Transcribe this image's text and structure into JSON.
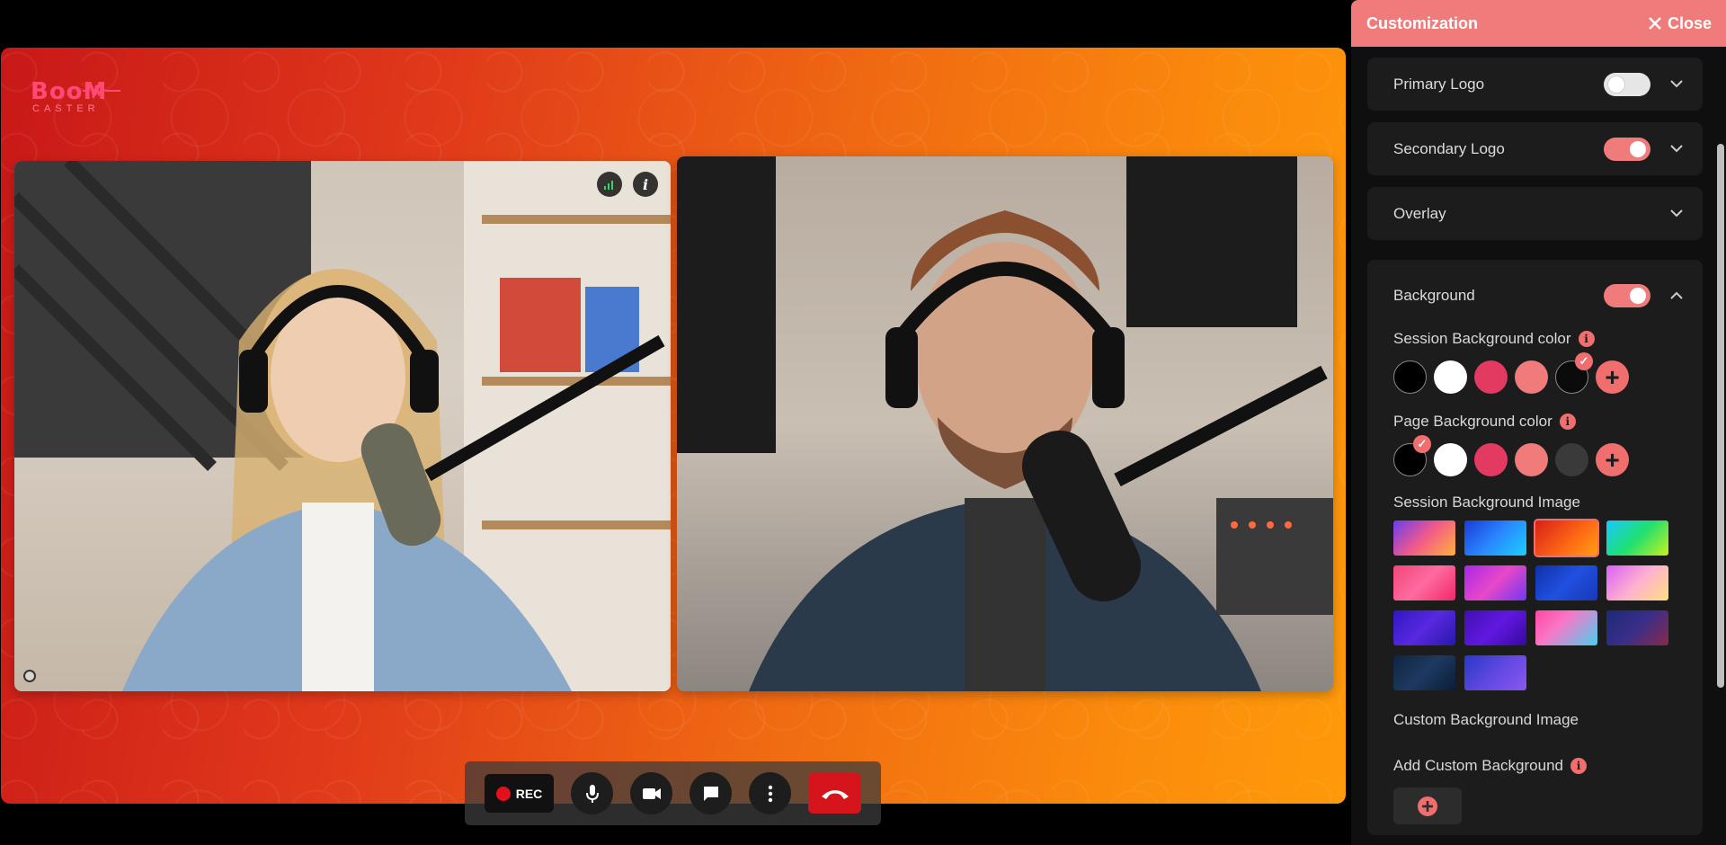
{
  "brand": {
    "name_top": "BooM",
    "name_bottom": "CASTER"
  },
  "controls": {
    "rec_label": "REC"
  },
  "panel": {
    "title": "Customization",
    "close_label": "Close",
    "sections": {
      "primary_logo": {
        "label": "Primary Logo",
        "toggle": "off"
      },
      "secondary_logo": {
        "label": "Secondary Logo",
        "toggle": "on"
      },
      "overlay": {
        "label": "Overlay"
      },
      "background": {
        "label": "Background",
        "toggle": "on",
        "session_bg_color_label": "Session Background color",
        "page_bg_color_label": "Page Background color",
        "session_bg_image_label": "Session Background Image",
        "custom_bg_image_label": "Custom Background Image",
        "add_custom_bg_label": "Add Custom Background"
      }
    },
    "session_colors": [
      "#000000",
      "#ffffff",
      "#e23a60",
      "#f07b7b",
      "#0b0b0b"
    ],
    "page_colors": [
      "#000000",
      "#ffffff",
      "#e23a60",
      "#f07b7b",
      "#3a3a3a"
    ],
    "session_color_selected": 4,
    "page_color_selected": 0,
    "bg_images": [
      "linear-gradient(135deg,#6a3df0,#f25a8a 50%,#ffb23a)",
      "linear-gradient(135deg,#1a3ad8,#2a88ff 50%,#1ad0ff)",
      "linear-gradient(135deg,#d8201a,#ff6a14 60%,#ffa014)",
      "linear-gradient(135deg,#18c8ff,#20e070 50%,#c8f020)",
      "linear-gradient(135deg,#f04878,#ff6aa0 50%,#f02868)",
      "linear-gradient(135deg,#a828e8,#e848c8 50%,#7038f0)",
      "linear-gradient(135deg,#1030a8,#2050e0 50%,#1838b8)",
      "linear-gradient(135deg,#d860f8,#ffb0d0 50%,#ffe080)",
      "linear-gradient(135deg,#3018c0,#5828e0 50%,#2818a8)",
      "linear-gradient(135deg,#4010b0,#6018e0 50%,#3808a0)",
      "linear-gradient(135deg,#ff48a0,#f878c8 40%,#48d0f0)",
      "linear-gradient(135deg,#1c2a78,#3a2e88 50%,#882a48)",
      "linear-gradient(135deg,#102440,#1e3a60 50%,#0c1c38)",
      "linear-gradient(135deg,#2838c8,#6048e0 50%,#8a58f0)"
    ],
    "bg_image_selected": 2
  },
  "accent": "#f07b7b"
}
